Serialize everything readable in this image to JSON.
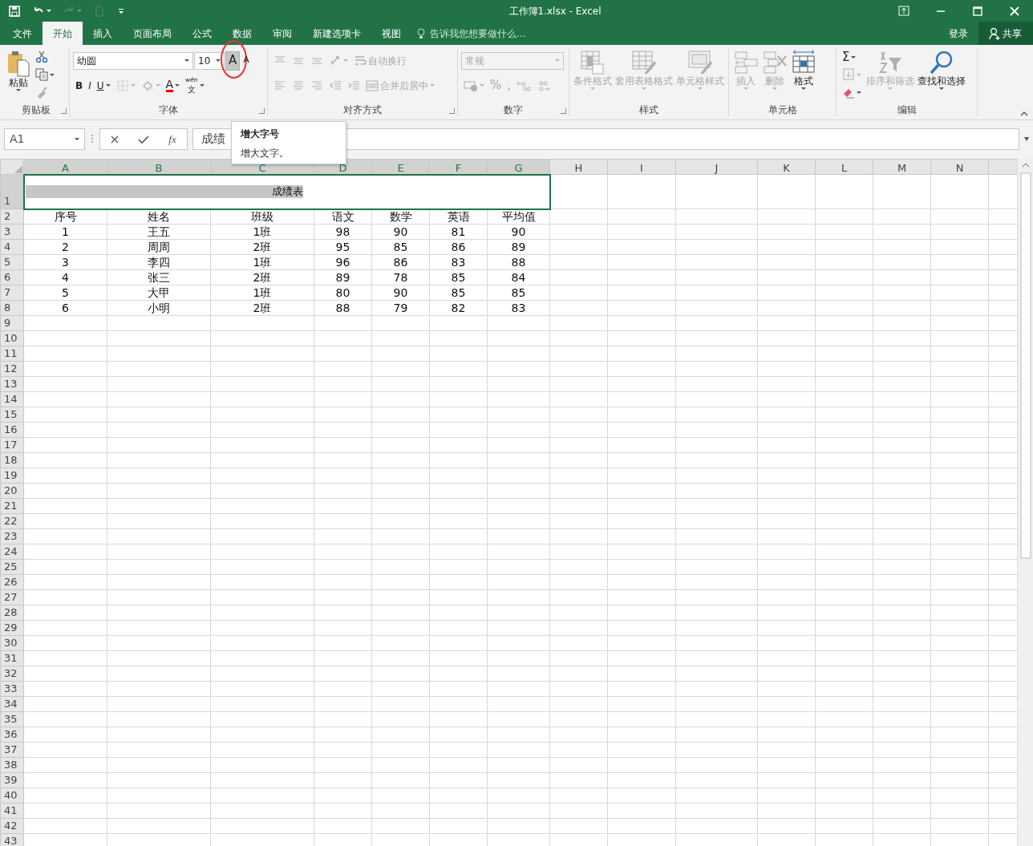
{
  "window": {
    "title": "工作簿1.xlsx - Excel"
  },
  "quick_access": [
    {
      "dropdown": false,
      "disabled": false
    },
    {
      "dropdown": true,
      "disabled": false
    },
    {
      "dropdown": true,
      "disabled": true
    },
    {
      "dropdown": false,
      "disabled": true
    }
  ],
  "tabs": [
    {
      "label": "文件",
      "selected": false
    },
    {
      "label": "开始",
      "selected": true
    },
    {
      "label": "插入",
      "selected": false
    },
    {
      "label": "页面布局",
      "selected": false
    },
    {
      "label": "公式",
      "selected": false
    },
    {
      "label": "数据",
      "selected": false
    },
    {
      "label": "审阅",
      "selected": false
    },
    {
      "label": "新建选项卡",
      "selected": false
    },
    {
      "label": "视图",
      "selected": false
    }
  ],
  "tell_me": {
    "placeholder": "告诉我您想要做什么..."
  },
  "account": {
    "sign_in": "登录",
    "share": "共享"
  },
  "ribbon": [
    {
      "label": "剪贴板",
      "launcher": true,
      "items": [
        {
          "kind": "large",
          "label": "粘贴",
          "dropdown": true,
          "disabled": false
        },
        {
          "kind": "stack",
          "lines": [
            {
              "controls": [
                {
                  "dropdown": false,
                  "disabled": false
                }
              ]
            },
            {
              "controls": [
                {
                  "dropdown": true,
                  "disabled": false
                }
              ]
            },
            {
              "controls": [
                {
                  "dropdown": false,
                  "disabled": true
                }
              ]
            }
          ]
        }
      ]
    },
    {
      "label": "字体",
      "launcher": true,
      "items": [
        {
          "kind": "stack",
          "lines": [
            {
              "controls": [
                {
                  "kind": "combo",
                  "value": "幼圆",
                  "disabled": false
                },
                {
                  "kind": "combo",
                  "value": "10",
                  "disabled": false
                },
                {
                  "text": "A",
                  "kind": "grow",
                  "dropdown": false,
                  "disabled": false,
                  "highlighted": true
                },
                {
                  "text": "A",
                  "kind": "shrink",
                  "dropdown": false,
                  "disabled": false,
                  "highlighted": false
                }
              ]
            },
            {
              "controls": [
                {
                  "text": "B",
                  "kind": "bold",
                  "dropdown": false,
                  "disabled": false
                },
                {
                  "text": "I",
                  "kind": "italic",
                  "dropdown": false,
                  "disabled": false
                },
                {
                  "text": "U",
                  "kind": "underline",
                  "dropdown": true,
                  "disabled": false
                },
                {
                  "dropdown": true,
                  "disabled": true
                },
                {
                  "dropdown": true,
                  "disabled": true
                },
                {
                  "text": "A",
                  "kind": "color",
                  "dropdown": true,
                  "disabled": false
                },
                {
                  "text": "文",
                  "ruby": "wén",
                  "dropdown": true,
                  "disabled": false
                }
              ]
            }
          ]
        }
      ]
    },
    {
      "label": "对齐方式",
      "launcher": true,
      "items": [
        {
          "kind": "stack",
          "lines": [
            {
              "controls": [
                {
                  "dropdown": false,
                  "disabled": true
                },
                {
                  "dropdown": false,
                  "disabled": true
                },
                {
                  "dropdown": false,
                  "disabled": true
                },
                {
                  "dropdown": true,
                  "disabled": true
                },
                {
                  "label": "自动换行",
                  "dropdown": false,
                  "disabled": true
                }
              ]
            },
            {
              "controls": [
                {
                  "dropdown": false,
                  "disabled": true
                },
                {
                  "dropdown": false,
                  "disabled": true
                },
                {
                  "dropdown": false,
                  "disabled": true
                },
                {
                  "dropdown": false,
                  "disabled": true
                },
                {
                  "dropdown": false,
                  "disabled": true
                },
                {
                  "label": "合并后居中",
                  "dropdown": true,
                  "disabled": true
                }
              ]
            }
          ]
        }
      ]
    },
    {
      "label": "数字",
      "launcher": true,
      "items": [
        {
          "kind": "stack",
          "lines": [
            {
              "controls": [
                {
                  "kind": "combo",
                  "value": "常规",
                  "disabled": true
                }
              ]
            },
            {
              "controls": [
                {
                  "dropdown": true,
                  "disabled": true
                },
                {
                  "text": "%",
                  "dropdown": false,
                  "disabled": true
                },
                {
                  "text": ",",
                  "dropdown": false,
                  "disabled": true
                },
                {
                  "dropdown": false,
                  "disabled": true
                },
                {
                  "dropdown": false,
                  "disabled": true
                }
              ]
            }
          ]
        }
      ]
    },
    {
      "label": "样式",
      "items": [
        {
          "kind": "large",
          "label": "条件格式",
          "dropdown": true,
          "disabled": true
        },
        {
          "kind": "large",
          "label": "套用表格格式",
          "dropdown": true,
          "disabled": true
        },
        {
          "kind": "large",
          "label": "单元格样式",
          "dropdown": true,
          "disabled": true
        }
      ]
    },
    {
      "label": "单元格",
      "items": [
        {
          "kind": "large",
          "label": "插入",
          "dropdown": true,
          "disabled": true
        },
        {
          "kind": "large",
          "label": "删除",
          "dropdown": true,
          "disabled": true
        },
        {
          "kind": "large",
          "label": "格式",
          "dropdown": true,
          "disabled": false
        }
      ]
    },
    {
      "label": "编辑",
      "items": [
        {
          "kind": "stack",
          "lines": [
            {
              "controls": [
                {
                  "text": "Σ",
                  "dropdown": true,
                  "disabled": false
                }
              ]
            },
            {
              "controls": [
                {
                  "dropdown": true,
                  "disabled": true
                }
              ]
            },
            {
              "controls": [
                {
                  "dropdown": true,
                  "disabled": false
                }
              ]
            }
          ]
        },
        {
          "kind": "large",
          "label": "排序和筛选",
          "dropdown": true,
          "disabled": true
        },
        {
          "kind": "large",
          "label": "查找和选择",
          "dropdown": true,
          "disabled": false
        }
      ]
    }
  ],
  "formula_bar": {
    "name_box": "A1",
    "insert_function": "fx",
    "value": "成绩"
  },
  "tooltip": {
    "title": "增大字号",
    "text": "增大文字。"
  },
  "sheet": {
    "columns": [
      {
        "label": "A",
        "selected": true
      },
      {
        "label": "B",
        "selected": true
      },
      {
        "label": "C",
        "selected": true
      },
      {
        "label": "D",
        "selected": true
      },
      {
        "label": "E",
        "selected": true
      },
      {
        "label": "F",
        "selected": true
      },
      {
        "label": "G",
        "selected": true
      },
      {
        "label": "H",
        "selected": false
      },
      {
        "label": "I",
        "selected": false
      },
      {
        "label": "J",
        "selected": false
      },
      {
        "label": "K",
        "selected": false
      },
      {
        "label": "L",
        "selected": false
      },
      {
        "label": "M",
        "selected": false
      },
      {
        "label": "N",
        "selected": false
      }
    ],
    "title_row": {
      "number": "1",
      "text": "成绩表",
      "selected": true
    },
    "rows": [
      {
        "number": "2",
        "cells": [
          "序号",
          "姓名",
          "班级",
          "语文",
          "数学",
          "英语",
          "平均值"
        ]
      },
      {
        "number": "3",
        "cells": [
          "1",
          "王五",
          "1班",
          "98",
          "90",
          "81",
          "90"
        ]
      },
      {
        "number": "4",
        "cells": [
          "2",
          "周周",
          "2班",
          "95",
          "85",
          "86",
          "89"
        ]
      },
      {
        "number": "5",
        "cells": [
          "3",
          "李四",
          "1班",
          "96",
          "86",
          "83",
          "88"
        ]
      },
      {
        "number": "6",
        "cells": [
          "4",
          "张三",
          "2班",
          "89",
          "78",
          "85",
          "84"
        ]
      },
      {
        "number": "7",
        "cells": [
          "5",
          "大甲",
          "1班",
          "80",
          "90",
          "85",
          "85"
        ]
      },
      {
        "number": "8",
        "cells": [
          "6",
          "小明",
          "2班",
          "88",
          "79",
          "82",
          "83"
        ]
      }
    ],
    "empty_rows": [
      "9",
      "10",
      "11",
      "12",
      "13",
      "14",
      "15",
      "16",
      "17",
      "18",
      "19",
      "20",
      "21",
      "22",
      "23",
      "24",
      "25",
      "26",
      "27",
      "28",
      "29",
      "30",
      "31",
      "32",
      "33",
      "34",
      "35",
      "36",
      "37",
      "38",
      "39",
      "40",
      "41",
      "42",
      "43"
    ]
  }
}
